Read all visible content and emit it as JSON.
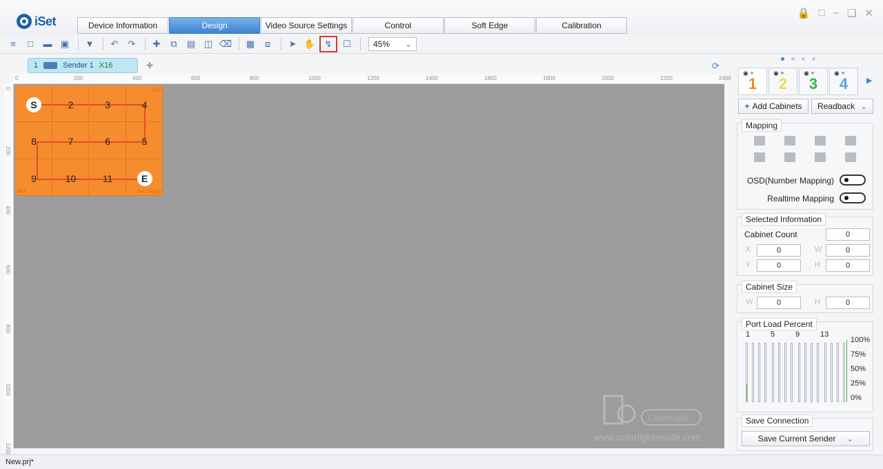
{
  "app": {
    "name": "iSet"
  },
  "tabs": [
    "Device Information",
    "Design",
    "Video Source Settings",
    "Control",
    "Soft Edge",
    "Calibration"
  ],
  "active_tab": "Design",
  "toolbar": {
    "zoom": "45%"
  },
  "sender_tab": {
    "index": "1",
    "label": "Sender 1",
    "code": "X16"
  },
  "ruler": {
    "h": [
      "0",
      "200",
      "400",
      "600",
      "800",
      "1000",
      "1200",
      "1400",
      "1600",
      "1800",
      "2000",
      "2200",
      "2400"
    ],
    "v": [
      "0",
      "200",
      "400",
      "600",
      "800",
      "1000",
      "1200"
    ]
  },
  "wall": {
    "labels": [
      "S",
      "2",
      "3",
      "4",
      "8",
      "7",
      "6",
      "5",
      "9",
      "10",
      "11",
      "E"
    ],
    "top_right": "512",
    "bottom_left": "384",
    "bottom_right": "No Signal"
  },
  "watermark": {
    "brand": "Colorlight",
    "url": "www.colorlightinside.com"
  },
  "panel": {
    "tabs": [
      "1",
      "2",
      "3",
      "4"
    ],
    "add_cabinets": "Add Cabinets",
    "readback": "Readback",
    "mapping": {
      "title": "Mapping",
      "osd": "OSD(Number Mapping)",
      "realtime": "Realtime Mapping"
    },
    "selected": {
      "title": "Selected Information",
      "cabinet_count_label": "Cabinet Count",
      "cabinet_count": "0",
      "x_label": "X",
      "x": "0",
      "w_label": "W",
      "w": "0",
      "y_label": "Y",
      "y": "0",
      "h_label": "H",
      "h": "0"
    },
    "cabinet_size": {
      "title": "Cabinet Size",
      "w_label": "W",
      "w": "0",
      "h_label": "H",
      "h": "0"
    },
    "port_load": {
      "title": "Port Load Percent",
      "ports": [
        "1",
        "5",
        "9",
        "13"
      ],
      "levels": [
        "100%",
        "75%",
        "50%",
        "25%",
        "0%"
      ],
      "port1_load": 0.3
    },
    "save_connection": {
      "title": "Save Connection",
      "button": "Save Current Sender"
    }
  },
  "status": {
    "file": "New.prj*"
  },
  "colors": {
    "accent": "#3b82d3",
    "wall": "#f58c2e",
    "canvas": "#9c9c9c",
    "highlight": "#d6372e"
  }
}
